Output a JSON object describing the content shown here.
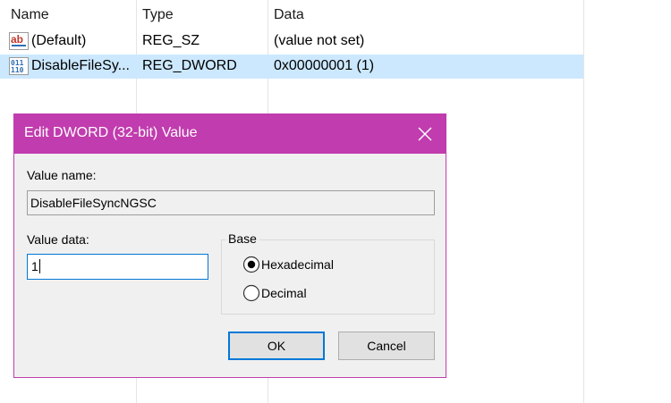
{
  "registry": {
    "columns": [
      "Name",
      "Type",
      "Data"
    ],
    "rows": [
      {
        "name": "(Default)",
        "type": "REG_SZ",
        "data": "(value not set)",
        "icon": "reg-string-icon"
      },
      {
        "name": "DisableFileSy...",
        "type": "REG_DWORD",
        "data": "0x00000001 (1)",
        "icon": "reg-binary-icon",
        "selected": true
      }
    ]
  },
  "dialog": {
    "title": "Edit DWORD (32-bit) Value",
    "value_name_label": "Value name:",
    "value_name": "DisableFileSyncNGSC",
    "value_data_label": "Value data:",
    "value_data": "1",
    "base_label": "Base",
    "base_options": [
      {
        "label": "Hexadecimal",
        "checked": true
      },
      {
        "label": "Decimal",
        "checked": false
      }
    ],
    "ok_label": "OK",
    "cancel_label": "Cancel"
  },
  "colors": {
    "title_bar": "#c13cae",
    "selection": "#cce8ff",
    "focus": "#0078d7"
  }
}
